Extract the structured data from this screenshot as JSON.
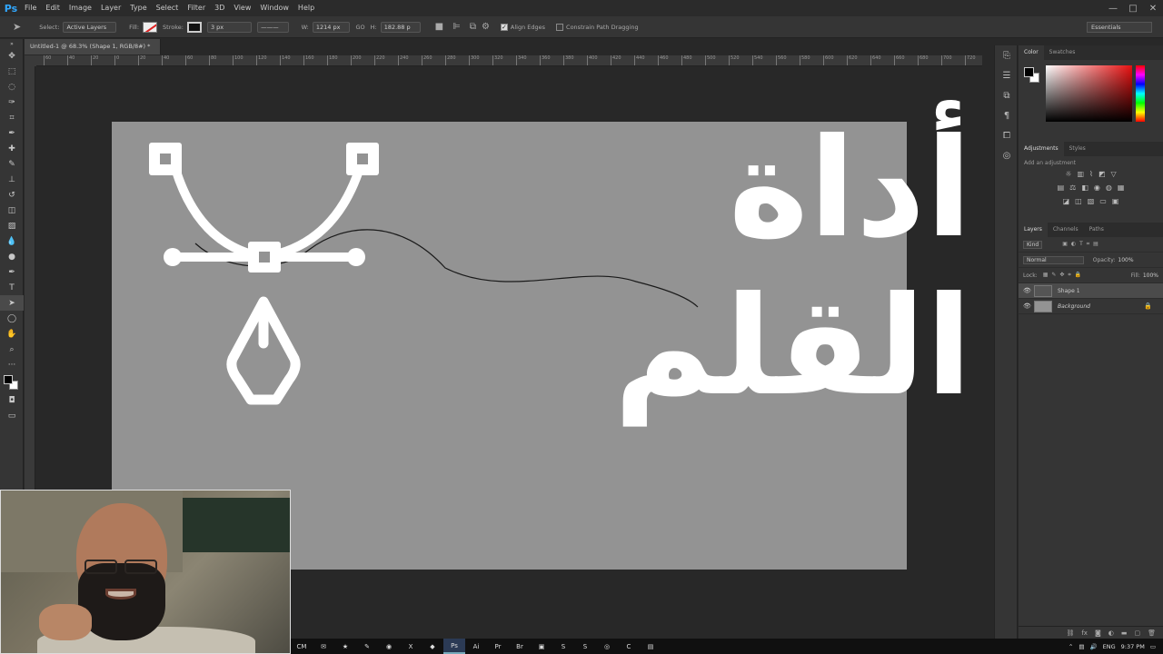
{
  "app": {
    "logo": "Ps",
    "menu": [
      "File",
      "Edit",
      "Image",
      "Layer",
      "Type",
      "Select",
      "Filter",
      "3D",
      "View",
      "Window",
      "Help"
    ],
    "window_controls": [
      "—",
      "□",
      "✕"
    ]
  },
  "options_bar": {
    "select_label": "Select:",
    "select_value": "Active Layers",
    "fill_label": "Fill:",
    "stroke_label": "Stroke:",
    "stroke_width": "3 px",
    "w_label": "W:",
    "w_value": "1214 px",
    "link_label": "GO",
    "h_label": "H:",
    "h_value": "182.88 p",
    "align_edges": "Align Edges",
    "constrain": "Constrain Path Dragging",
    "workspace": "Essentials"
  },
  "document": {
    "tab_title": "Untitled-1 @ 68.3% (Shape 1, RGB/8#) *",
    "ruler_ticks": [
      "60",
      "40",
      "20",
      "0",
      "20",
      "40",
      "60",
      "80",
      "100",
      "120",
      "140",
      "160",
      "180",
      "200",
      "220",
      "240",
      "260",
      "280",
      "300",
      "320",
      "340",
      "360",
      "380",
      "400",
      "420",
      "440",
      "460",
      "480",
      "500",
      "520",
      "540",
      "560",
      "580",
      "600",
      "620",
      "640",
      "660",
      "680",
      "700",
      "720"
    ],
    "canvas_title": "أداة القلم",
    "canvas_color": "#939393"
  },
  "panels": {
    "color_tabs": [
      "Color",
      "Swatches"
    ],
    "adjustments_tabs": [
      "Adjustments",
      "Styles"
    ],
    "adjustments_hint": "Add an adjustment",
    "layers_tabs": [
      "Layers",
      "Channels",
      "Paths"
    ],
    "filter_kind": "Kind",
    "blend_mode": "Normal",
    "opacity_label": "Opacity:",
    "opacity_value": "100%",
    "lock_label": "Lock:",
    "fill_label": "Fill:",
    "fill_value": "100%",
    "layers": [
      {
        "name": "Shape 1",
        "selected": true
      },
      {
        "name": "Background",
        "selected": false
      }
    ]
  },
  "taskbar": {
    "apps": [
      "CM",
      "✉",
      "★",
      "✎",
      "◉",
      "X",
      "◆",
      "Ps",
      "Ai",
      "Pr",
      "Br",
      "▣",
      "S",
      "S",
      "◎",
      "C",
      "▤"
    ],
    "language": "ENG",
    "time": "9:37 PM"
  }
}
